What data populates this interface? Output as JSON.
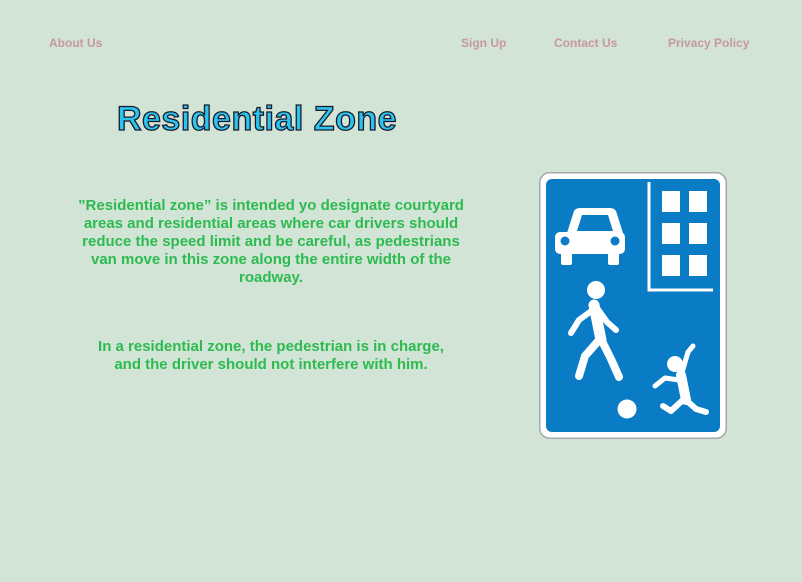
{
  "nav": {
    "about": "About Us",
    "sign_up": "Sign Up",
    "contact": "Contact Us",
    "privacy": "Privacy Policy"
  },
  "main": {
    "title": "Residential Zone",
    "paragraph_1": "”Residential zone” is intended yo designate courtyard areas and residential areas where car drivers should reduce the speed limit and be careful, as pedestrians van move in this zone along the entire width of the roadway.",
    "paragraph_2": "In a residential zone, the pedestrian is in charge, and the driver should not interfere with him."
  },
  "colors": {
    "background": "#d1e4d6",
    "nav_text": "#c8989a",
    "title_fill": "#2bc4ee",
    "body_text": "#2dbb4f",
    "sign_blue": "#0a7bc5",
    "sign_border": "#a8a8a8"
  },
  "image": {
    "icon": "residential-zone-road-sign"
  }
}
